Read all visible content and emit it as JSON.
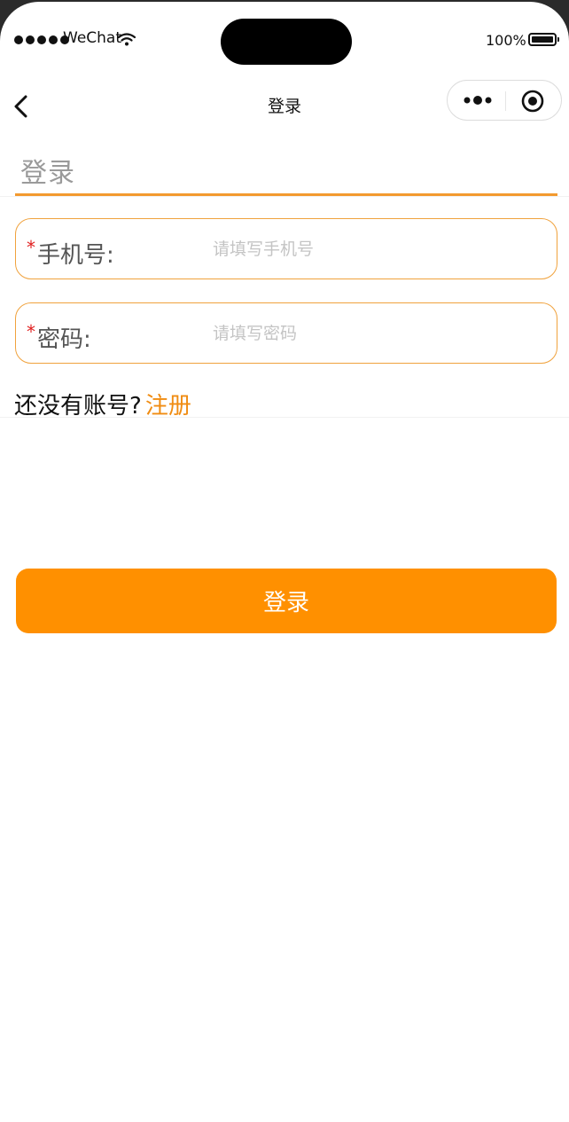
{
  "status_bar": {
    "carrier": "WeChat",
    "battery": "100%"
  },
  "nav": {
    "title": "登录"
  },
  "page": {
    "heading": "登录"
  },
  "form": {
    "required_mark": "*",
    "phone": {
      "label": "手机号:",
      "placeholder": "请填写手机号",
      "value": ""
    },
    "password": {
      "label": "密码:",
      "placeholder": "请填写密码",
      "value": ""
    }
  },
  "register": {
    "prompt": "还没有账号?",
    "link": "注册"
  },
  "login_button": {
    "label": "登录"
  },
  "colors": {
    "accent": "#ff9000",
    "link": "#f08c12",
    "required": "#e02020",
    "placeholder": "#c4c4c4"
  },
  "icons": {
    "back": "chevron-left-icon",
    "menu": "more-dots-icon",
    "close": "target-circle-icon",
    "wifi": "wifi-icon",
    "battery": "battery-icon",
    "signal": "signal-dots-icon"
  }
}
